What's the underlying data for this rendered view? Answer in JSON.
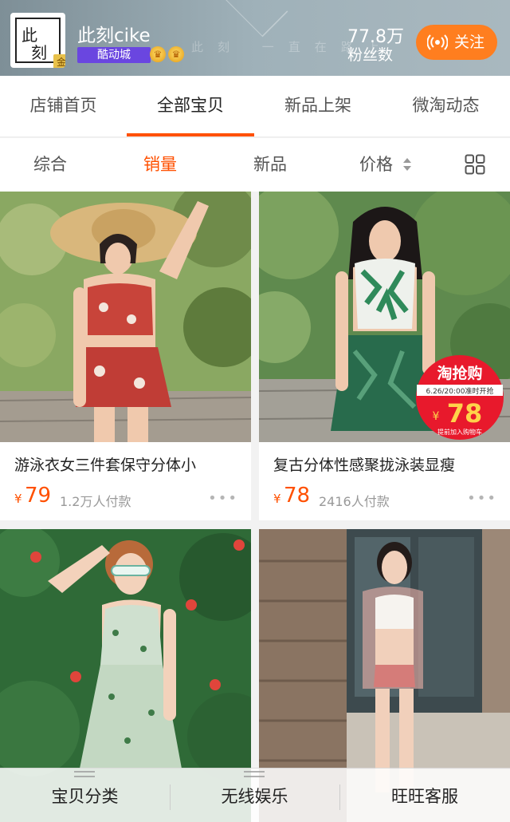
{
  "header": {
    "shop_name": "此刻cike",
    "logo_char_1": "此",
    "logo_char_2": "刻",
    "logo_badge": "金",
    "mall_badge": "酷动城",
    "crown_glyph": "♛",
    "watermark": "此刻 一直在路上",
    "fans_count": "77.8万",
    "fans_label": "粉丝数",
    "follow_label": "关注"
  },
  "tabs": [
    {
      "label": "店铺首页",
      "active": false
    },
    {
      "label": "全部宝贝",
      "active": true
    },
    {
      "label": "新品上架",
      "active": false
    },
    {
      "label": "微淘动态",
      "active": false
    }
  ],
  "sort": [
    {
      "label": "综合",
      "active": false
    },
    {
      "label": "销量",
      "active": true
    },
    {
      "label": "新品",
      "active": false
    },
    {
      "label": "价格",
      "active": false
    }
  ],
  "products": [
    {
      "title": "游泳衣女三件套保守分体小",
      "currency": "¥",
      "price": "79",
      "sales": "1.2万人付款"
    },
    {
      "title": "复古分体性感聚拢泳装显瘦",
      "currency": "¥",
      "price": "78",
      "sales": "2416人付款",
      "promo": {
        "name": "淘抢购",
        "time": "6.26/20:00准时开抢",
        "currency": "¥",
        "price": "78",
        "note": "提前加入购物车"
      }
    },
    {
      "title": "",
      "currency": "",
      "price": "",
      "sales": ""
    },
    {
      "title": "",
      "currency": "",
      "price": "",
      "sales": ""
    }
  ],
  "bottom_menu": [
    {
      "label": "宝贝分类"
    },
    {
      "label": "无线娱乐"
    },
    {
      "label": "旺旺客服"
    }
  ],
  "colors": {
    "accent": "#ff5000",
    "follow": "#ff7e1f",
    "mall_badge": "#6a46e0",
    "promo_red": "#e8192c"
  },
  "icons": {
    "follow": "radio-waves-icon",
    "sort_price": "sort-arrows-icon",
    "view_mode": "grid-view-icon",
    "more": "more-dots-icon",
    "menu": "hamburger-icon"
  }
}
